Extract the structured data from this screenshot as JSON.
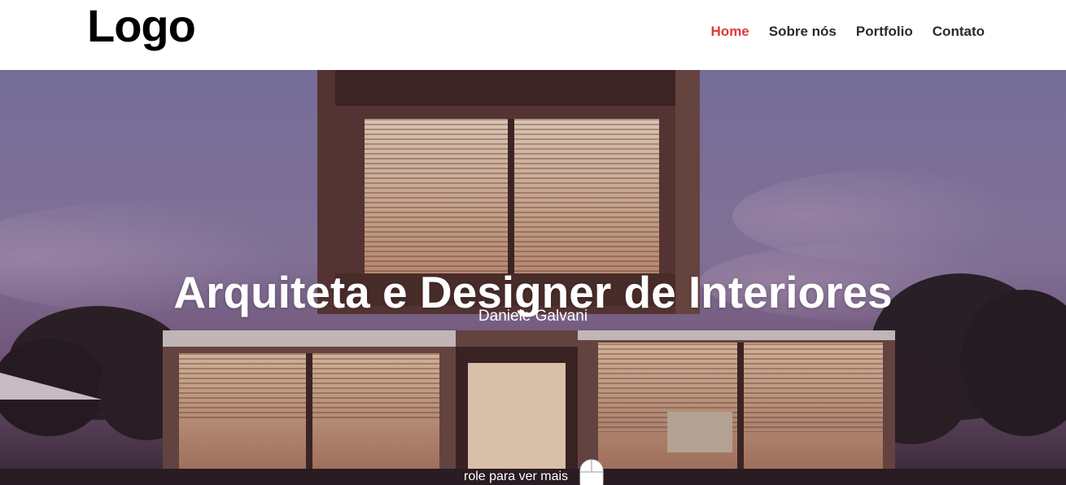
{
  "header": {
    "logo": "Logo",
    "nav": [
      {
        "label": "Home",
        "active": true
      },
      {
        "label": "Sobre nós",
        "active": false
      },
      {
        "label": "Portfolio",
        "active": false
      },
      {
        "label": "Contato",
        "active": false
      }
    ]
  },
  "hero": {
    "title": "Arquiteta e Designer de Interiores",
    "subtitle": "Daniele Galvani",
    "scroll_hint": "role para ver mais",
    "scroll_icon": "mouse-icon"
  },
  "colors": {
    "active_nav": "#e0383a",
    "nav_text": "#2b2b2b",
    "header_bg": "#ffffff",
    "sky": "#7e6f9a"
  }
}
